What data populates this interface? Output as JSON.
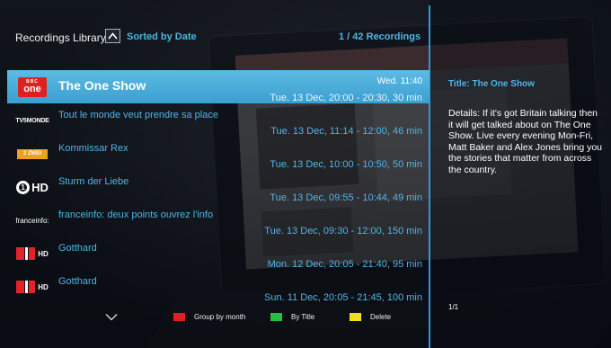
{
  "header": {
    "title": "Recordings Library",
    "sort_label": "Sorted by Date",
    "count": "1 / 42 Recordings"
  },
  "recordings": [
    {
      "channel": "BBC One",
      "title": "The One Show",
      "weekday": "Wed. 11:40",
      "date": "Tue. 13 Dec, 20:00 - 20:30, 30 min",
      "selected": true
    },
    {
      "channel": "TV5 Monde",
      "title": "Tout le monde veut prendre sa place",
      "weekday": "",
      "date": "Tue. 13 Dec, 11:14 - 12:00, 46 min",
      "selected": false
    },
    {
      "channel": "ZDF Zwei",
      "title": "Kommissar Rex",
      "weekday": "",
      "date": "Tue. 13 Dec, 10:00 - 10:50, 50 min",
      "selected": false
    },
    {
      "channel": "Das Erste HD",
      "title": "Sturm der Liebe",
      "weekday": "",
      "date": "Tue. 13 Dec, 09:55 - 10:44, 49 min",
      "selected": false
    },
    {
      "channel": "franceinfo",
      "title": "franceinfo: deux points ouvrez l'info",
      "weekday": "",
      "date": "Tue. 13 Dec, 09:30 - 12:00, 150 min",
      "selected": false
    },
    {
      "channel": "SRF 1 HD",
      "title": "Gotthard",
      "weekday": "",
      "date": "Mon. 12 Dec, 20:05 - 21:40, 95 min",
      "selected": false
    },
    {
      "channel": "SRF 1 HD",
      "title": "Gotthard",
      "weekday": "",
      "date": "Sun. 11 Dec, 20:05 - 21:45, 100 min",
      "selected": false
    }
  ],
  "logos": {
    "bbc_top": "BBC",
    "bbc_one": "one",
    "tv5": "TV5MONDE",
    "zwei": "2 ZWEI",
    "das_circle": "1",
    "das_hd": "HD",
    "franceinfo": "franceinfo:",
    "srf_hd": "HD"
  },
  "legend": [
    {
      "color": "#e02020",
      "label": "Group by month"
    },
    {
      "color": "#22c040",
      "label": "By Title"
    },
    {
      "color": "#f0e020",
      "label": "Delete"
    }
  ],
  "details": {
    "title": "Title: The One Show",
    "body": "Details: If it's got Britain talking then it will get talked about on The One Show. Live every evening Mon-Fri, Matt Baker and Alex Jones bring you the stories that matter from across the country.",
    "page": "1/1"
  },
  "icons": {
    "sort": "chevron-up-icon",
    "scroll_down": "chevron-down-icon"
  },
  "colors": {
    "accent": "#4fb5e6",
    "selection": "#3b9fd0",
    "divider": "#2c9bd2"
  }
}
